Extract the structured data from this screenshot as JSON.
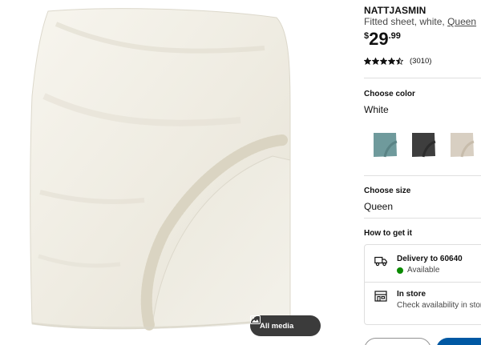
{
  "media": {
    "all_media_label": "All media",
    "image_icon": "image-gallery-icon"
  },
  "product": {
    "name": "NATTJASMIN",
    "description": "Fitted sheet, white,",
    "size_link": "Queen",
    "price": {
      "currency": "$",
      "integer": "29",
      "decimals": ".99"
    },
    "rating": {
      "value": 4.5,
      "max": 5,
      "count": "(3010)"
    }
  },
  "color": {
    "title": "Choose color",
    "selected": "White",
    "swatches": [
      {
        "name": "swatch-blue",
        "fill": "#6f9a9c"
      },
      {
        "name": "swatch-dark-gray",
        "fill": "#3e3e3e"
      },
      {
        "name": "swatch-beige",
        "fill": "#d8cfc2"
      }
    ]
  },
  "size": {
    "title": "Choose size",
    "selected": "Queen"
  },
  "fulfillment": {
    "title": "How to get it",
    "delivery": {
      "title": "Delivery to 60640",
      "status": "Available",
      "icon": "truck-icon",
      "status_color": "#0a8a00"
    },
    "store": {
      "title": "In store",
      "subtitle": "Check availability in stores",
      "icon": "store-icon"
    }
  },
  "colors": {
    "accent": "#0058a3",
    "divider": "#dfdfdf"
  }
}
